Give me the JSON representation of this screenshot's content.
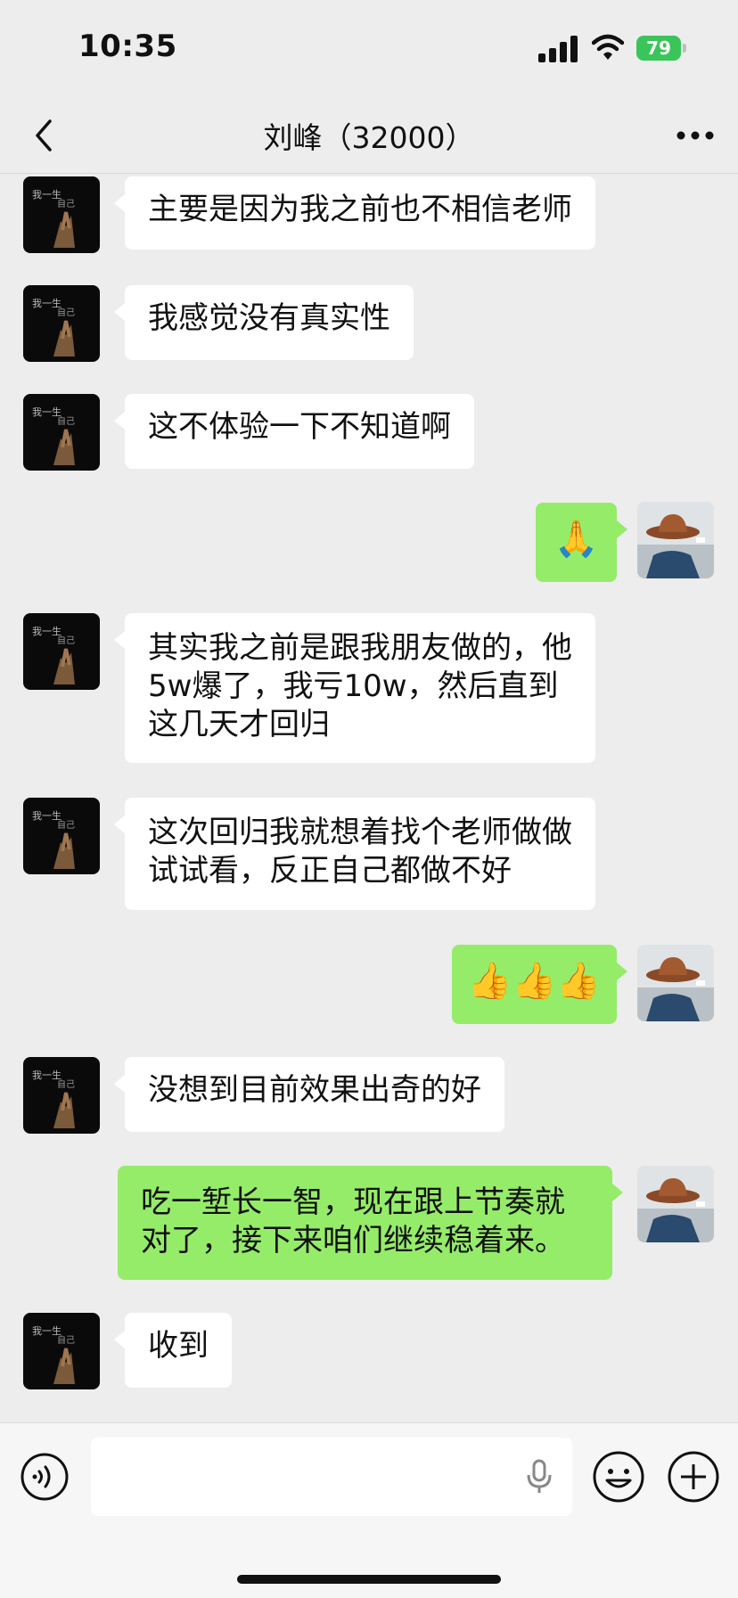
{
  "status_bar": {
    "time": "10:35",
    "battery": "79"
  },
  "nav": {
    "title": "刘峰（32000）"
  },
  "messages": [
    {
      "side": "in",
      "text": "主要是因为我之前也不相信老师"
    },
    {
      "side": "in",
      "text": "我感觉没有真实性"
    },
    {
      "side": "in",
      "text": "这不体验一下不知道啊"
    },
    {
      "side": "out",
      "text": "🙏"
    },
    {
      "side": "in",
      "lines": [
        "其实我之前是跟我朋友做的，他",
        "5w爆了，我亏10w，然后直到",
        "这几天才回归"
      ]
    },
    {
      "side": "in",
      "lines": [
        "这次回归我就想着找个老师做做",
        "试试看，反正自己都做不好"
      ]
    },
    {
      "side": "out",
      "text": "👍👍👍"
    },
    {
      "side": "in",
      "text": "没想到目前效果出奇的好"
    },
    {
      "side": "out",
      "lines": [
        "吃一堑长一智，现在跟上节奏就",
        "对了，接下来咱们继续稳着来。"
      ]
    },
    {
      "side": "in",
      "text": "收到"
    }
  ],
  "colors": {
    "incoming_bubble": "#ffffff",
    "outgoing_bubble": "#95ec69",
    "background": "#ededed",
    "battery": "#3ac55a"
  },
  "icons": [
    "back-icon",
    "more-icon",
    "voice-icon",
    "mic-icon",
    "emoji-icon",
    "add-icon"
  ]
}
